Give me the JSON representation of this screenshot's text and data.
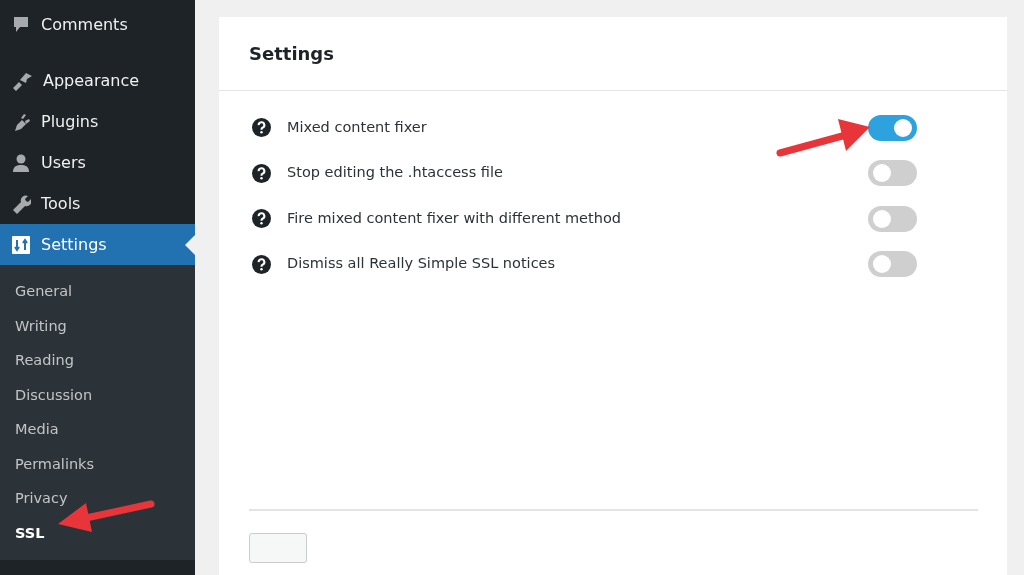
{
  "sidebar": {
    "menu": [
      {
        "label": "Comments",
        "selected": false
      },
      {
        "label": "Appearance",
        "selected": false
      },
      {
        "label": "Plugins",
        "selected": false
      },
      {
        "label": "Users",
        "selected": false
      },
      {
        "label": "Tools",
        "selected": false
      },
      {
        "label": "Settings",
        "selected": true
      }
    ],
    "submenu": [
      {
        "label": "General",
        "selected": false
      },
      {
        "label": "Writing",
        "selected": false
      },
      {
        "label": "Reading",
        "selected": false
      },
      {
        "label": "Discussion",
        "selected": false
      },
      {
        "label": "Media",
        "selected": false
      },
      {
        "label": "Permalinks",
        "selected": false
      },
      {
        "label": "Privacy",
        "selected": false
      },
      {
        "label": "SSL",
        "selected": true
      }
    ]
  },
  "settings": {
    "title": "Settings",
    "options": [
      {
        "label": "Mixed content fixer",
        "on": true
      },
      {
        "label": "Stop editing the .htaccess file",
        "on": false
      },
      {
        "label": "Fire mixed content fixer with different method",
        "on": false
      },
      {
        "label": "Dismiss all Really Simple SSL notices",
        "on": false
      }
    ]
  }
}
